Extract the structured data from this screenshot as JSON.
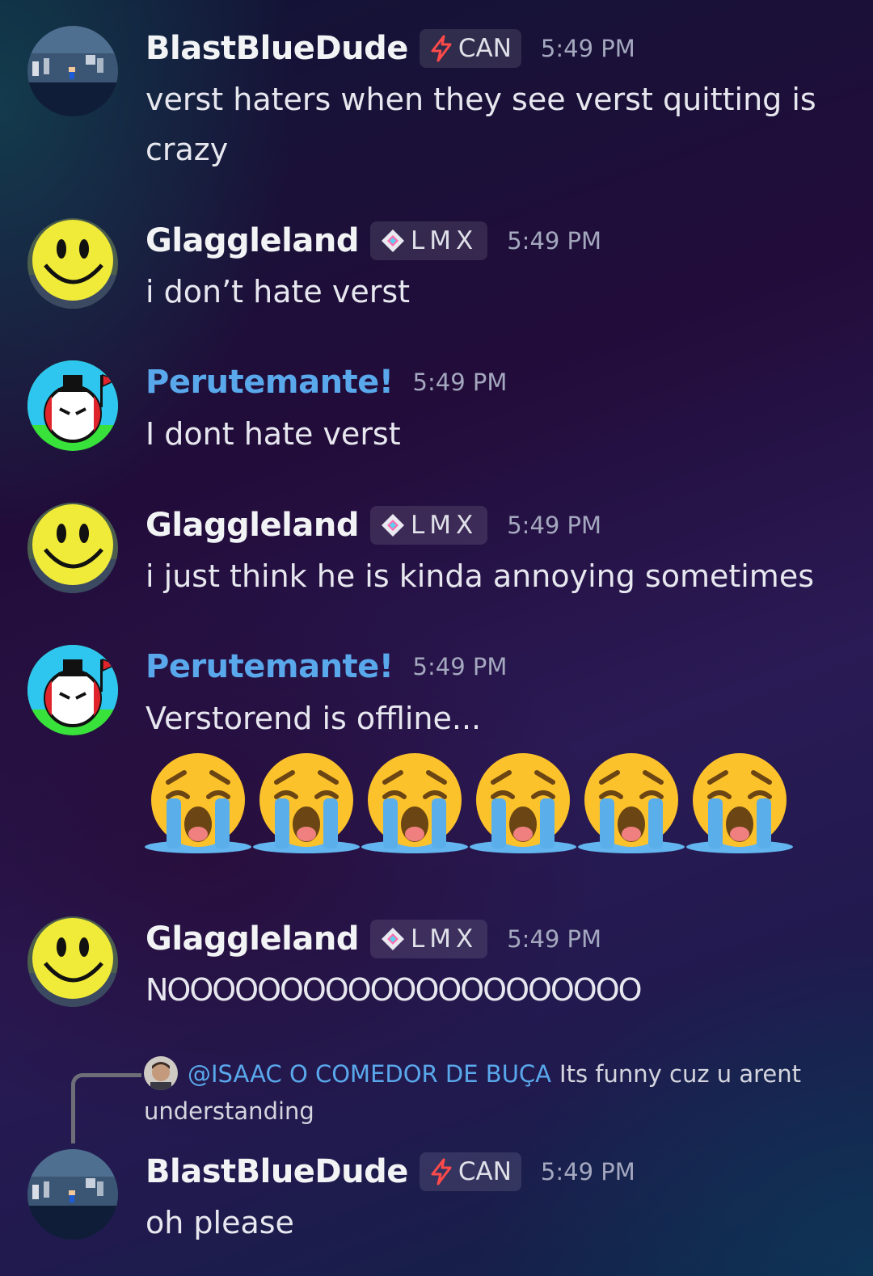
{
  "messages": [
    {
      "username": "BlastBlueDude",
      "tag": "CAN",
      "time": "5:49 PM",
      "text": "verst haters when they see verst quitting is crazy"
    },
    {
      "username": "Glaggleland",
      "tag": "LMX",
      "time": "5:49 PM",
      "text": "i don’t hate verst"
    },
    {
      "username": "Perutemante!",
      "time": "5:49 PM",
      "text": "I dont hate verst"
    },
    {
      "username": "Glaggleland",
      "tag": "LMX",
      "time": "5:49 PM",
      "text": "i just think he is kinda annoying sometimes"
    },
    {
      "username": "Perutemante!",
      "time": "5:49 PM",
      "text": "Verstorend is offline...",
      "emoji_count": 6,
      "emoji_name": "loudly-crying-face"
    },
    {
      "username": "Glaggleland",
      "tag": "LMX",
      "time": "5:49 PM",
      "text": "NOOOOOOOOOOOOOOOOOOOOO"
    },
    {
      "username": "BlastBlueDude",
      "tag": "CAN",
      "time": "5:49 PM",
      "text": "oh please",
      "reply": {
        "mention": "@ISAAC O COMEDOR DE BUÇA",
        "text": "Its funny cuz u arent understanding"
      }
    }
  ],
  "colors": {
    "username_default": "#f2f3f5",
    "username_blue": "#5aa8ec",
    "timestamp": "#a4a8bf",
    "tag_bg": "rgba(255,255,255,0.11)"
  },
  "icons": {
    "can_tag": "lightning-bolt-icon",
    "lmx_tag": "diamond-sparkle-icon"
  }
}
